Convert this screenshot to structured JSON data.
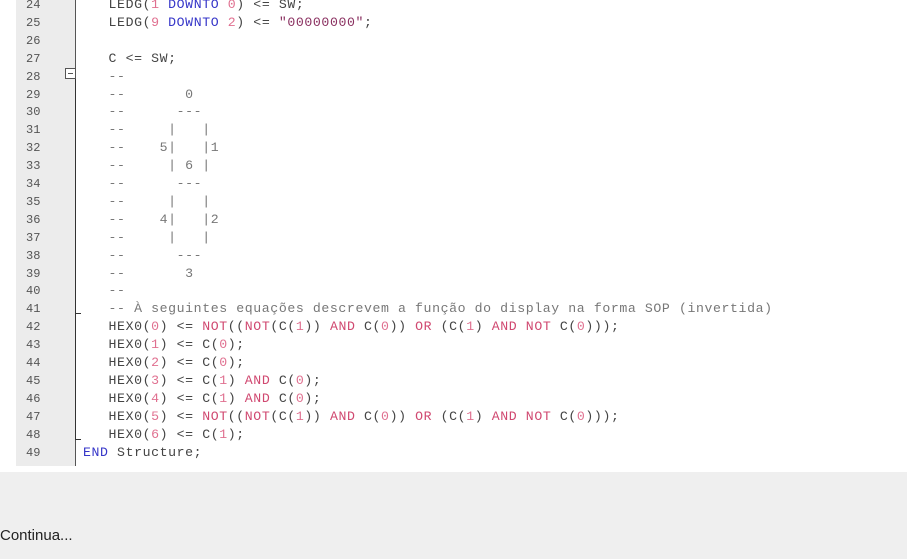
{
  "editor": {
    "lines": [
      {
        "n": "24",
        "tokens": [
          [
            "plain",
            "   LEDG("
          ],
          [
            "num",
            "1"
          ],
          [
            "plain",
            " "
          ],
          [
            "kw",
            "DOWNTO"
          ],
          [
            "plain",
            " "
          ],
          [
            "num",
            "0"
          ],
          [
            "plain",
            ") <= SW;"
          ]
        ]
      },
      {
        "n": "25",
        "tokens": [
          [
            "plain",
            "   LEDG("
          ],
          [
            "num",
            "9"
          ],
          [
            "plain",
            " "
          ],
          [
            "kw",
            "DOWNTO"
          ],
          [
            "plain",
            " "
          ],
          [
            "num",
            "2"
          ],
          [
            "plain",
            ") <= "
          ],
          [
            "str",
            "\"00000000\""
          ],
          [
            "plain",
            ";"
          ]
        ]
      },
      {
        "n": "26",
        "tokens": []
      },
      {
        "n": "27",
        "tokens": [
          [
            "plain",
            "   C <= SW;"
          ]
        ]
      },
      {
        "n": "28",
        "tokens": [
          [
            "com",
            "   --"
          ]
        ]
      },
      {
        "n": "29",
        "tokens": [
          [
            "com",
            "   --       0"
          ]
        ]
      },
      {
        "n": "30",
        "tokens": [
          [
            "com",
            "   --      ---"
          ]
        ]
      },
      {
        "n": "31",
        "tokens": [
          [
            "com",
            "   --     |   |"
          ]
        ]
      },
      {
        "n": "32",
        "tokens": [
          [
            "com",
            "   --    5|   |1"
          ]
        ]
      },
      {
        "n": "33",
        "tokens": [
          [
            "com",
            "   --     | 6 |"
          ]
        ]
      },
      {
        "n": "34",
        "tokens": [
          [
            "com",
            "   --      ---"
          ]
        ]
      },
      {
        "n": "35",
        "tokens": [
          [
            "com",
            "   --     |   |"
          ]
        ]
      },
      {
        "n": "36",
        "tokens": [
          [
            "com",
            "   --    4|   |2"
          ]
        ]
      },
      {
        "n": "37",
        "tokens": [
          [
            "com",
            "   --     |   |"
          ]
        ]
      },
      {
        "n": "38",
        "tokens": [
          [
            "com",
            "   --      ---"
          ]
        ]
      },
      {
        "n": "39",
        "tokens": [
          [
            "com",
            "   --       3"
          ]
        ]
      },
      {
        "n": "40",
        "tokens": [
          [
            "com",
            "   --"
          ]
        ]
      },
      {
        "n": "41",
        "tokens": [
          [
            "com",
            "   -- À seguintes equações descrevem a função do display na forma SOP (invertida)"
          ]
        ]
      },
      {
        "n": "42",
        "tokens": [
          [
            "plain",
            "   HEX0("
          ],
          [
            "num",
            "0"
          ],
          [
            "plain",
            ") <= "
          ],
          [
            "op",
            "NOT"
          ],
          [
            "plain",
            "(("
          ],
          [
            "op",
            "NOT"
          ],
          [
            "plain",
            "(C("
          ],
          [
            "num",
            "1"
          ],
          [
            "plain",
            ")) "
          ],
          [
            "op",
            "AND"
          ],
          [
            "plain",
            " C("
          ],
          [
            "num",
            "0"
          ],
          [
            "plain",
            ")) "
          ],
          [
            "op",
            "OR"
          ],
          [
            "plain",
            " (C("
          ],
          [
            "num",
            "1"
          ],
          [
            "plain",
            ") "
          ],
          [
            "op",
            "AND NOT"
          ],
          [
            "plain",
            " C("
          ],
          [
            "num",
            "0"
          ],
          [
            "plain",
            ")));"
          ]
        ]
      },
      {
        "n": "43",
        "tokens": [
          [
            "plain",
            "   HEX0("
          ],
          [
            "num",
            "1"
          ],
          [
            "plain",
            ") <= C("
          ],
          [
            "num",
            "0"
          ],
          [
            "plain",
            ");"
          ]
        ]
      },
      {
        "n": "44",
        "tokens": [
          [
            "plain",
            "   HEX0("
          ],
          [
            "num",
            "2"
          ],
          [
            "plain",
            ") <= C("
          ],
          [
            "num",
            "0"
          ],
          [
            "plain",
            ");"
          ]
        ]
      },
      {
        "n": "45",
        "tokens": [
          [
            "plain",
            "   HEX0("
          ],
          [
            "num",
            "3"
          ],
          [
            "plain",
            ") <= C("
          ],
          [
            "num",
            "1"
          ],
          [
            "plain",
            ") "
          ],
          [
            "op",
            "AND"
          ],
          [
            "plain",
            " C("
          ],
          [
            "num",
            "0"
          ],
          [
            "plain",
            ");"
          ]
        ]
      },
      {
        "n": "46",
        "tokens": [
          [
            "plain",
            "   HEX0("
          ],
          [
            "num",
            "4"
          ],
          [
            "plain",
            ") <= C("
          ],
          [
            "num",
            "1"
          ],
          [
            "plain",
            ") "
          ],
          [
            "op",
            "AND"
          ],
          [
            "plain",
            " C("
          ],
          [
            "num",
            "0"
          ],
          [
            "plain",
            ");"
          ]
        ]
      },
      {
        "n": "47",
        "tokens": [
          [
            "plain",
            "   HEX0("
          ],
          [
            "num",
            "5"
          ],
          [
            "plain",
            ") <= "
          ],
          [
            "op",
            "NOT"
          ],
          [
            "plain",
            "(("
          ],
          [
            "op",
            "NOT"
          ],
          [
            "plain",
            "(C("
          ],
          [
            "num",
            "1"
          ],
          [
            "plain",
            ")) "
          ],
          [
            "op",
            "AND"
          ],
          [
            "plain",
            " C("
          ],
          [
            "num",
            "0"
          ],
          [
            "plain",
            ")) "
          ],
          [
            "op",
            "OR"
          ],
          [
            "plain",
            " (C("
          ],
          [
            "num",
            "1"
          ],
          [
            "plain",
            ") "
          ],
          [
            "op",
            "AND NOT"
          ],
          [
            "plain",
            " C("
          ],
          [
            "num",
            "0"
          ],
          [
            "plain",
            ")));"
          ]
        ]
      },
      {
        "n": "48",
        "tokens": [
          [
            "plain",
            "   HEX0("
          ],
          [
            "num",
            "6"
          ],
          [
            "plain",
            ") <= C("
          ],
          [
            "num",
            "1"
          ],
          [
            "plain",
            ");"
          ]
        ]
      },
      {
        "n": "49",
        "tokens": [
          [
            "kw",
            "END"
          ],
          [
            "plain",
            " Structure;"
          ]
        ]
      }
    ]
  },
  "caption": "Continua..."
}
